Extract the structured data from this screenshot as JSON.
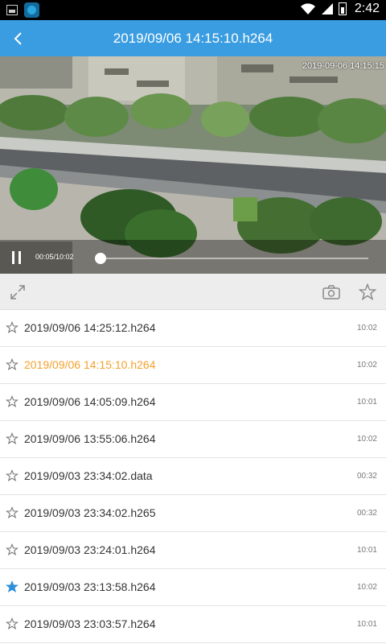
{
  "status_bar": {
    "left_icons": [
      "image-icon",
      "app-icon"
    ],
    "right_icons": [
      "wifi-icon",
      "signal-icon",
      "battery-icon"
    ],
    "time": "2:42"
  },
  "header": {
    "back_icon": "chevron-left-icon",
    "title": "2019/09/06 14:15:10.h264",
    "color": "#3a9de1"
  },
  "player": {
    "osd_timestamp": "2019-09-06 14:15:15",
    "state_icon": "pause-icon",
    "progress_label": "00:05/10:02",
    "progress_fraction": 0.008
  },
  "toolbar": {
    "fullscreen_icon": "expand-icon",
    "snapshot_icon": "camera-icon",
    "favorite_icon": "star-outline-icon"
  },
  "recordings": [
    {
      "name": "2019/09/06 14:25:12.h264",
      "duration": "10:02",
      "starred": false,
      "active": false
    },
    {
      "name": "2019/09/06 14:15:10.h264",
      "duration": "10:02",
      "starred": false,
      "active": true
    },
    {
      "name": "2019/09/06 14:05:09.h264",
      "duration": "10:01",
      "starred": false,
      "active": false
    },
    {
      "name": "2019/09/06 13:55:06.h264",
      "duration": "10:02",
      "starred": false,
      "active": false
    },
    {
      "name": "2019/09/03 23:34:02.data",
      "duration": "00:32",
      "starred": false,
      "active": false
    },
    {
      "name": "2019/09/03 23:34:02.h265",
      "duration": "00:32",
      "starred": false,
      "active": false
    },
    {
      "name": "2019/09/03 23:24:01.h264",
      "duration": "10:01",
      "starred": false,
      "active": false
    },
    {
      "name": "2019/09/03 23:13:58.h264",
      "duration": "10:02",
      "starred": true,
      "active": false
    },
    {
      "name": "2019/09/03 23:03:57.h264",
      "duration": "10:01",
      "starred": false,
      "active": false
    }
  ],
  "colors": {
    "active_text": "#f3a12b",
    "starred": "#2f8fd8"
  }
}
